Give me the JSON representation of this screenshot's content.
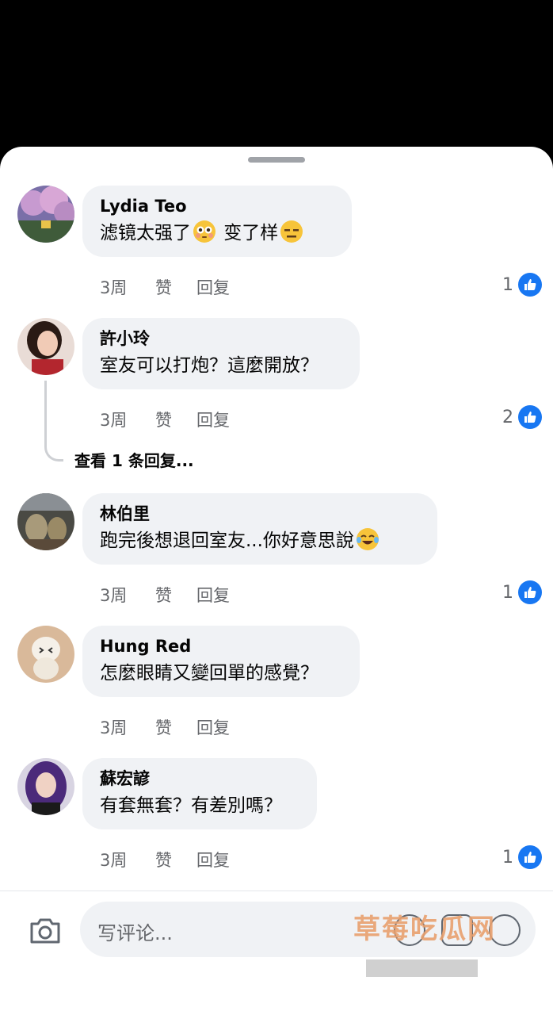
{
  "composer": {
    "placeholder": "写评论...",
    "watermark": "草莓吃瓜网",
    "watermark_url": "www.cmcgw.com"
  },
  "actions": {
    "like": "赞",
    "reply": "回复"
  },
  "view_replies": "查看 1 条回复...",
  "comments": [
    {
      "author": "Lydia Teo",
      "text_a": "滤镜太强了",
      "emoji_a": "flushed-face-emoji",
      "text_b": " 变了样",
      "emoji_b": "expressionless-face-emoji",
      "time": "3周",
      "likes": "1"
    },
    {
      "author": "許小玲",
      "text_a": "室友可以打炮？這麼開放？",
      "time": "3周",
      "likes": "2"
    },
    {
      "author": "林伯里",
      "text_a": "跑完後想退回室友...你好意思說",
      "emoji_a": "tears-of-joy-emoji",
      "time": "3周",
      "likes": "1"
    },
    {
      "author": "Hung Red",
      "text_a": "怎麼眼睛又變回單的感覺？",
      "time": "3周",
      "likes": ""
    },
    {
      "author": "蘇宏諺",
      "text_a": "有套無套？有差別嗎？",
      "time": "3周",
      "likes": "1"
    }
  ],
  "colors": {
    "accent": "#1877f2",
    "bubble": "#f0f2f5",
    "meta": "#65676b"
  }
}
